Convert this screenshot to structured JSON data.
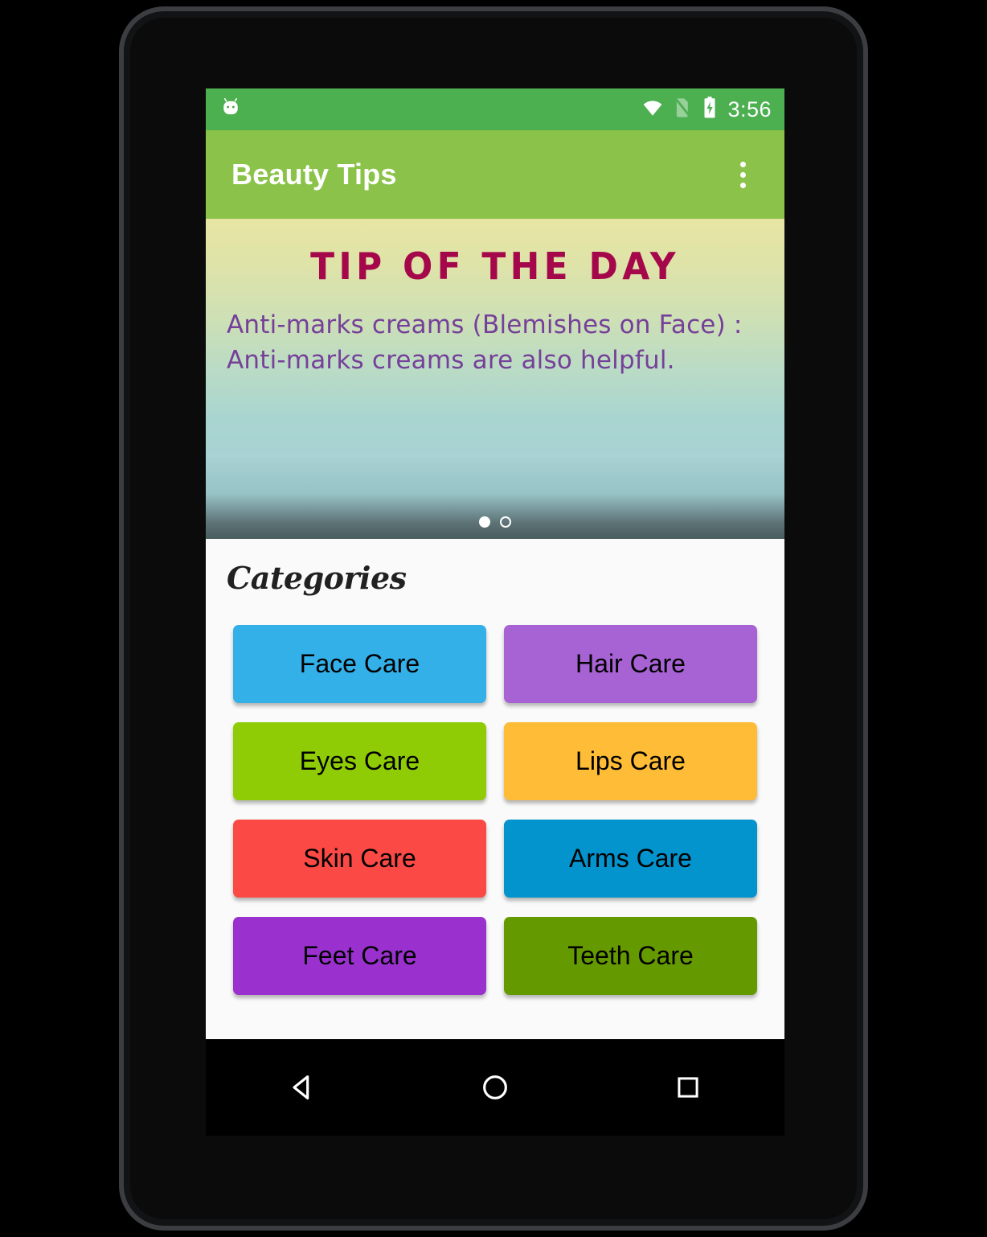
{
  "status_bar": {
    "clock": "3:56",
    "icons": [
      "android-head-icon",
      "wifi-icon",
      "no-sim-icon",
      "battery-charging-icon"
    ],
    "background": "#4caf50"
  },
  "app_bar": {
    "title": "Beauty Tips",
    "background": "#8bc34a",
    "overflow_icon": "more-vert-icon"
  },
  "tip_banner": {
    "title": "TIP OF THE DAY",
    "text": "Anti-marks creams (Blemishes on Face) : Anti-marks creams are also helpful.",
    "title_color": "#a5084a",
    "text_color": "#76409a",
    "page_indicator": {
      "total": 2,
      "active_index": 0
    }
  },
  "categories": {
    "heading": "Categories",
    "items": [
      {
        "label": "Face Care",
        "color": "#34b0e8"
      },
      {
        "label": "Hair Care",
        "color": "#a763d4"
      },
      {
        "label": "Eyes Care",
        "color": "#8fcc06"
      },
      {
        "label": "Lips Care",
        "color": "#ffbc36"
      },
      {
        "label": "Skin Care",
        "color": "#fb4a45"
      },
      {
        "label": "Arms Care",
        "color": "#0494cd"
      },
      {
        "label": "Feet Care",
        "color": "#9a31cf"
      },
      {
        "label": "Teeth Care",
        "color": "#649900"
      }
    ]
  },
  "nav_bar": {
    "buttons": [
      {
        "name": "back-icon"
      },
      {
        "name": "home-icon"
      },
      {
        "name": "recents-icon"
      }
    ]
  }
}
